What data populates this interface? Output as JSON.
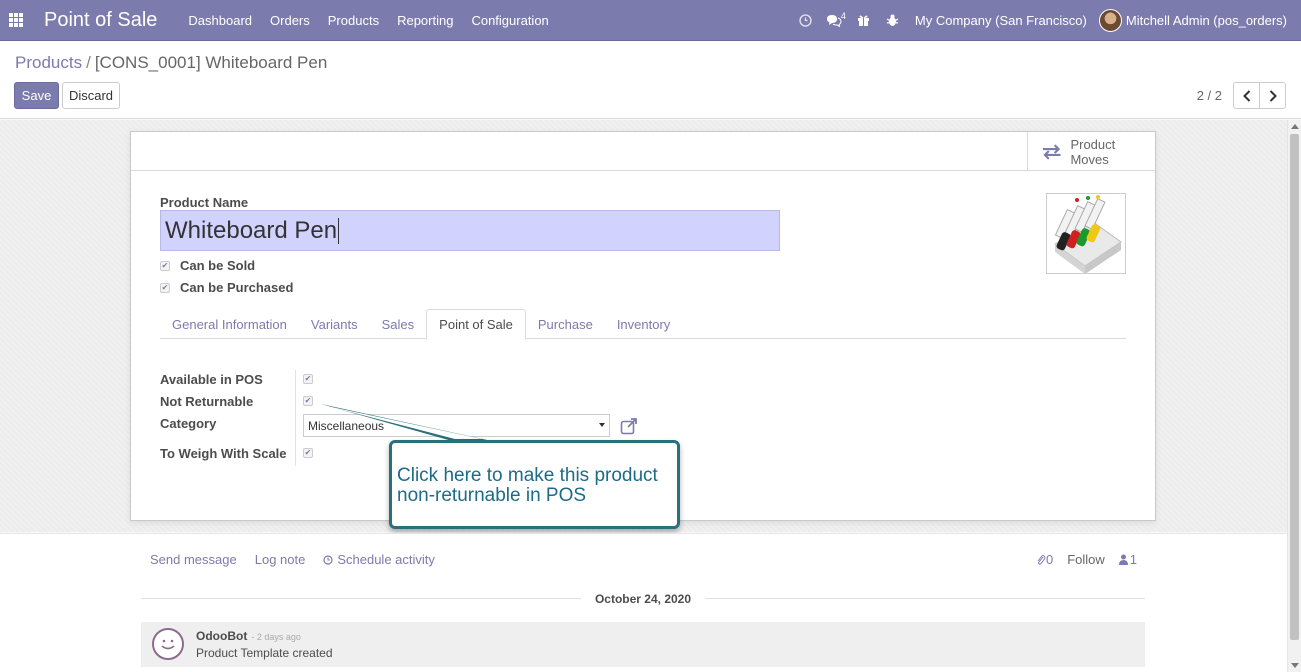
{
  "navbar": {
    "app_title": "Point of Sale",
    "menu": [
      "Dashboard",
      "Orders",
      "Products",
      "Reporting",
      "Configuration"
    ],
    "messages_badge": "4",
    "company": "My Company (San Francisco)",
    "user": "Mitchell Admin (pos_orders)",
    "icons": [
      "apps-icon",
      "clock-icon",
      "chat-icon",
      "gift-icon",
      "bug-icon"
    ]
  },
  "control_panel": {
    "breadcrumb_parent": "Products",
    "breadcrumb_separator": "/",
    "breadcrumb_current": "[CONS_0001] Whiteboard Pen",
    "save_label": "Save",
    "discard_label": "Discard",
    "pager": "2 / 2"
  },
  "form": {
    "smart_button_label": "Product Moves",
    "product_name_label": "Product Name",
    "product_name_value": "Whiteboard Pen",
    "can_be_sold_label": "Can be Sold",
    "can_be_sold": true,
    "can_be_purchased_label": "Can be Purchased",
    "can_be_purchased": true,
    "tabs": [
      "General Information",
      "Variants",
      "Sales",
      "Point of Sale",
      "Purchase",
      "Inventory"
    ],
    "active_tab": "Point of Sale",
    "pos": {
      "available_label": "Available in POS",
      "available": true,
      "not_returnable_label": "Not Returnable",
      "not_returnable": true,
      "category_label": "Category",
      "category_value": "Miscellaneous",
      "weigh_label": "To Weigh With Scale",
      "weigh": true
    }
  },
  "callout": {
    "text_line1": "Click here to make this product",
    "text_line2": "non-returnable in POS",
    "border_color": "#2b6f7c",
    "text_color": "#1d6b87"
  },
  "chatter": {
    "send_message": "Send message",
    "log_note": "Log note",
    "schedule_activity": "Schedule activity",
    "attachments_count": "0",
    "follow": "Follow",
    "followers_count": "1",
    "date_separator": "October 24, 2020",
    "message": {
      "author": "OdooBot",
      "time": "- 2 days ago",
      "body": "Product Template created"
    }
  },
  "colors": {
    "brand": "#7c7bad",
    "input_highlight": "#d2d2ff"
  }
}
